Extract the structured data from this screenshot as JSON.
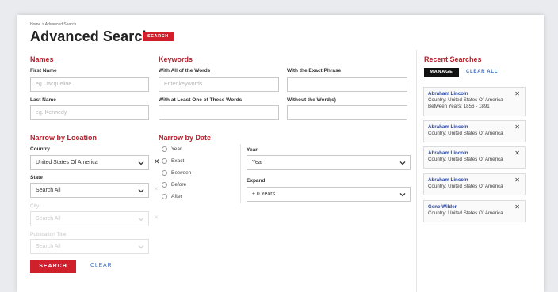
{
  "breadcrumb": "Home > Advanced Search",
  "page": {
    "title": "Advanced Search",
    "badge": "SEARCH"
  },
  "names": {
    "title": "Names",
    "first_name": {
      "label": "First Name",
      "placeholder": "eg. Jacqueline"
    },
    "last_name": {
      "label": "Last Name",
      "placeholder": "eg. Kennedy"
    }
  },
  "keywords": {
    "title": "Keywords",
    "all_words": {
      "label": "With All of the Words",
      "placeholder": "Enter keywords"
    },
    "exact_phrase": {
      "label": "With the Exact Phrase",
      "placeholder": ""
    },
    "one_of_words": {
      "label": "With at Least One of These Words",
      "placeholder": ""
    },
    "without_words": {
      "label": "Without the Word(s)",
      "placeholder": ""
    }
  },
  "location": {
    "title": "Narrow by Location",
    "country": {
      "label": "Country",
      "value": "United States Of America"
    },
    "state": {
      "label": "State",
      "value": "Search All"
    },
    "city": {
      "label": "City",
      "value": "Search All"
    },
    "publication": {
      "label": "Publication Title",
      "value": "Search All"
    }
  },
  "date": {
    "title": "Narrow by Date",
    "options": [
      "Year",
      "Exact",
      "Between",
      "Before",
      "After"
    ],
    "year": {
      "label": "Year",
      "value": "Year"
    },
    "expand": {
      "label": "Expand",
      "value": "± 0 Years"
    }
  },
  "actions": {
    "search": "SEARCH",
    "clear": "CLEAR"
  },
  "recent": {
    "title": "Recent Searches",
    "manage": "MANAGE",
    "clear_all": "CLEAR ALL",
    "items": [
      {
        "name": "Abraham Lincoln",
        "country": "Country: United States Of America",
        "extra": "Between Years: 1856 - 1891"
      },
      {
        "name": "Abraham Lincoln",
        "country": "Country: United States Of America"
      },
      {
        "name": "Abraham Lincoln",
        "country": "Country: United States Of America"
      },
      {
        "name": "Abraham Lincoln",
        "country": "Country: United States Of America"
      },
      {
        "name": "Gene Wilder",
        "country": "Country: United States Of America"
      }
    ]
  },
  "colors": {
    "accent": "#d0202c",
    "section": "#b3202b",
    "link": "#3b6fc9",
    "dark": "#111111"
  },
  "icons": {
    "remove": "close-icon",
    "dropdown": "chevron-down-icon",
    "option": "radio-icon"
  }
}
